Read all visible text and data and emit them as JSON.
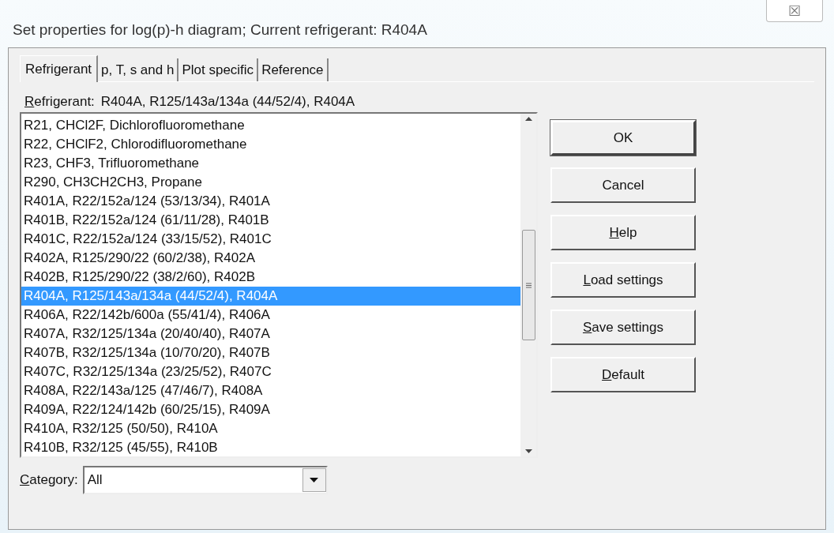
{
  "window": {
    "title": "Set properties for log(p)-h diagram; Current refrigerant: R404A",
    "close": "☒"
  },
  "tabs": [
    {
      "label": "Refrigerant",
      "selected": true
    },
    {
      "label": "p, T, s and h",
      "selected": false
    },
    {
      "label": "Plot specific",
      "selected": false
    },
    {
      "label": "Reference",
      "selected": false
    }
  ],
  "refrigerant_label": {
    "text": "Refrigerant:",
    "underline_first": true
  },
  "refrigerant_value": "R404A, R125/143a/134a (44/52/4), R404A",
  "list": [
    {
      "text": "R21, CHCl2F, Dichlorofluoromethane",
      "selected": false
    },
    {
      "text": "R22, CHClF2, Chlorodifluoromethane",
      "selected": false
    },
    {
      "text": "R23, CHF3, Trifluoromethane",
      "selected": false
    },
    {
      "text": "R290, CH3CH2CH3, Propane",
      "selected": false
    },
    {
      "text": "R401A, R22/152a/124 (53/13/34), R401A",
      "selected": false
    },
    {
      "text": "R401B, R22/152a/124 (61/11/28), R401B",
      "selected": false
    },
    {
      "text": "R401C, R22/152a/124 (33/15/52), R401C",
      "selected": false
    },
    {
      "text": "R402A, R125/290/22 (60/2/38), R402A",
      "selected": false
    },
    {
      "text": "R402B, R125/290/22 (38/2/60), R402B",
      "selected": false
    },
    {
      "text": "R404A, R125/143a/134a (44/52/4), R404A",
      "selected": true
    },
    {
      "text": "R406A, R22/142b/600a (55/41/4), R406A",
      "selected": false
    },
    {
      "text": "R407A, R32/125/134a (20/40/40), R407A",
      "selected": false
    },
    {
      "text": "R407B, R32/125/134a (10/70/20), R407B",
      "selected": false
    },
    {
      "text": "R407C, R32/125/134a (23/25/52), R407C",
      "selected": false
    },
    {
      "text": "R408A, R22/143a/125 (47/46/7), R408A",
      "selected": false
    },
    {
      "text": "R409A, R22/124/142b (60/25/15), R409A",
      "selected": false
    },
    {
      "text": "R410A, R32/125 (50/50), R410A",
      "selected": false
    },
    {
      "text": "R410B, R32/125 (45/55), R410B",
      "selected": false
    }
  ],
  "category": {
    "label": "Category:",
    "underline_first": true,
    "value": "All"
  },
  "buttons": [
    {
      "label": "OK",
      "default": true,
      "underline_first": false
    },
    {
      "label": "Cancel",
      "default": false,
      "underline_first": false
    },
    {
      "label": "Help",
      "default": false,
      "underline_first": true
    },
    {
      "label": "Load settings",
      "default": false,
      "underline_first": true
    },
    {
      "label": "Save settings",
      "default": false,
      "underline_first": true
    },
    {
      "label": "Default",
      "default": false,
      "underline_first": true
    }
  ]
}
